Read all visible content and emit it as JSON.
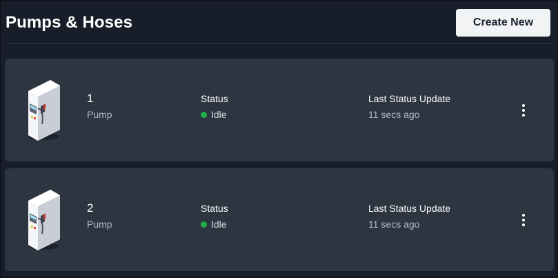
{
  "header": {
    "title": "Pumps & Hoses",
    "create_label": "Create New"
  },
  "pumps": [
    {
      "number": "1",
      "type": "Pump",
      "status_label": "Status",
      "status": "Idle",
      "update_label": "Last Status Update",
      "update_value": "11 secs ago",
      "icon": "fuel-pump-icon"
    },
    {
      "number": "2",
      "type": "Pump",
      "status_label": "Status",
      "status": "Idle",
      "update_label": "Last Status Update",
      "update_value": "11 secs ago",
      "icon": "fuel-pump-icon"
    }
  ],
  "colors": {
    "background": "#181e29",
    "card": "#2d3541",
    "status_idle": "#1fae4b",
    "button_bg": "#f2f3f5"
  }
}
